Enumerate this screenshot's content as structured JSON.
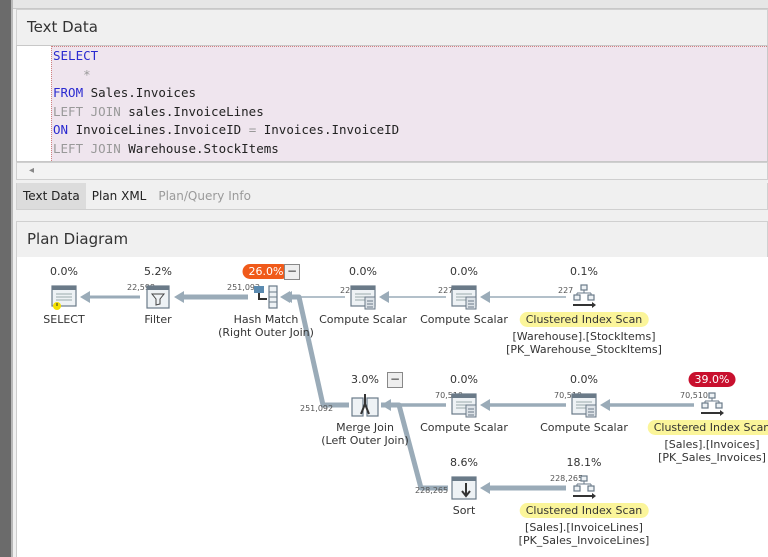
{
  "text_data": {
    "title": "Text Data",
    "lines": [
      [
        {
          "t": "SELECT",
          "c": "kw"
        }
      ],
      [
        {
          "t": "    *",
          "c": "gr"
        }
      ],
      [
        {
          "t": "FROM",
          "c": "kw"
        },
        {
          "t": " Sales.Invoices",
          "c": "tx"
        }
      ],
      [
        {
          "t": "LEFT JOIN",
          "c": "gr"
        },
        {
          "t": " sales.InvoiceLines",
          "c": "tx"
        }
      ],
      [
        {
          "t": "ON",
          "c": "kw"
        },
        {
          "t": " InvoiceLines.InvoiceID ",
          "c": "tx"
        },
        {
          "t": "=",
          "c": "gr"
        },
        {
          "t": " Invoices.InvoiceID",
          "c": "tx"
        }
      ],
      [
        {
          "t": "LEFT JOIN",
          "c": "gr"
        },
        {
          "t": " Warehouse.StockItems",
          "c": "tx"
        }
      ]
    ]
  },
  "scroll_left_icon": "◂",
  "tabs": [
    {
      "label": "Text Data",
      "active": true
    },
    {
      "label": "Plan XML"
    },
    {
      "label": "Plan/Query Info",
      "disabled": true
    }
  ],
  "plan": {
    "title": "Plan Diagram",
    "collapse_label": "−",
    "nodes": [
      {
        "id": "select",
        "cost": "0.0%",
        "label": "SELECT",
        "icon": "select-warning-icon"
      },
      {
        "id": "filter",
        "cost": "5.2%",
        "label": "Filter",
        "icon": "filter-icon"
      },
      {
        "id": "hash",
        "cost": "26.0%",
        "badge": "#f05a1a",
        "label": "Hash Match",
        "sub": "(Right Outer Join)",
        "icon": "hash-match-icon"
      },
      {
        "id": "cs1",
        "cost": "0.0%",
        "label": "Compute Scalar",
        "icon": "compute-scalar-icon"
      },
      {
        "id": "cs2",
        "cost": "0.0%",
        "label": "Compute Scalar",
        "icon": "compute-scalar-icon"
      },
      {
        "id": "cis1",
        "cost": "0.1%",
        "label": "Clustered Index Scan",
        "highlight": true,
        "sub": "[Warehouse].[StockItems]",
        "sub2": "[PK_Warehouse_StockItems]",
        "icon": "clustered-index-scan-icon"
      },
      {
        "id": "merge",
        "cost": "3.0%",
        "label": "Merge Join",
        "sub": "(Left Outer Join)",
        "icon": "merge-join-icon"
      },
      {
        "id": "cs3",
        "cost": "0.0%",
        "label": "Compute Scalar",
        "icon": "compute-scalar-icon"
      },
      {
        "id": "cs4",
        "cost": "0.0%",
        "label": "Compute Scalar",
        "icon": "compute-scalar-icon"
      },
      {
        "id": "cis2",
        "cost": "39.0%",
        "badge": "#c8102e",
        "label": "Clustered Index Scan",
        "highlight": true,
        "sub": "[Sales].[Invoices]",
        "sub2": "[PK_Sales_Invoices]",
        "icon": "clustered-index-scan-icon"
      },
      {
        "id": "sort",
        "cost": "8.6%",
        "label": "Sort",
        "icon": "sort-icon"
      },
      {
        "id": "cis3",
        "cost": "18.1%",
        "label": "Clustered Index Scan",
        "highlight": true,
        "sub": "[Sales].[InvoiceLines]",
        "sub2": "[PK_Sales_InvoiceLines]",
        "icon": "clustered-index-scan-icon"
      }
    ],
    "edges": [
      {
        "from": "filter",
        "to": "select",
        "rows": "22,598"
      },
      {
        "from": "hash",
        "to": "filter",
        "rows": "251,092"
      },
      {
        "from": "cs1",
        "to": "hash",
        "rows": "227"
      },
      {
        "from": "cs2",
        "to": "cs1",
        "rows": "227"
      },
      {
        "from": "cis1",
        "to": "cs2",
        "rows": "227"
      },
      {
        "from": "merge",
        "to": "hash",
        "rows": "251,092"
      },
      {
        "from": "cs3",
        "to": "merge",
        "rows": "70,510"
      },
      {
        "from": "cs4",
        "to": "cs3",
        "rows": "70,510"
      },
      {
        "from": "cis2",
        "to": "cs4",
        "rows": "70,510"
      },
      {
        "from": "sort",
        "to": "merge",
        "rows": "228,265"
      },
      {
        "from": "cis3",
        "to": "sort",
        "rows": "228,265"
      }
    ]
  },
  "colors": {
    "edge": "#9aabb8",
    "highlight": "#fbf59a"
  }
}
